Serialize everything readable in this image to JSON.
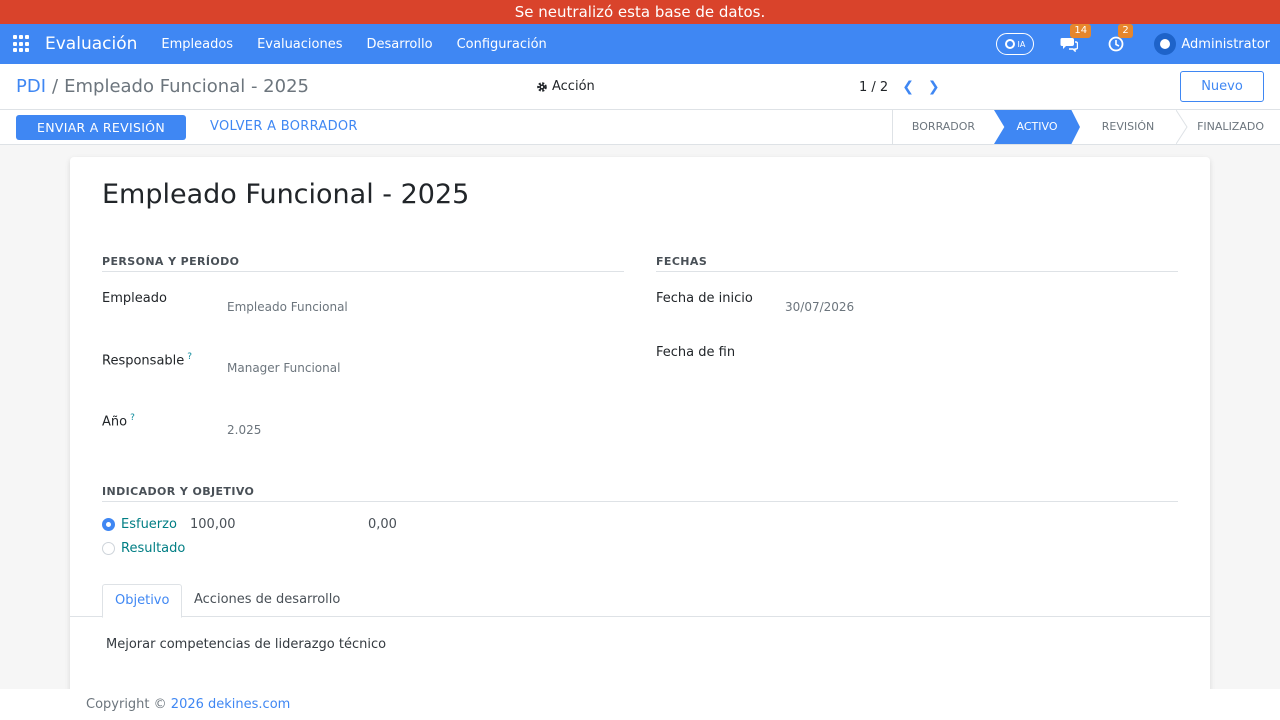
{
  "banner": {
    "text": "Se neutralizó esta base de datos."
  },
  "navbar": {
    "brand": "Evaluación",
    "menu": [
      "Empleados",
      "Evaluaciones",
      "Desarrollo",
      "Configuración"
    ],
    "ia_label": "IA",
    "messages_count": "14",
    "activities_count": "2",
    "user_name": "Administrator"
  },
  "control_panel": {
    "breadcrumb_root": "PDI",
    "breadcrumb_current": "Empleado Funcional - 2025",
    "action_label": "Acción",
    "pager": "1 / 2",
    "new_button": "Nuevo"
  },
  "statusbar": {
    "primary_button": "ENVIAR A REVISIÓN",
    "secondary_button": "VOLVER A BORRADOR",
    "stages": [
      "BORRADOR",
      "ACTIVO",
      "REVISIÓN",
      "FINALIZADO"
    ],
    "active_stage": "ACTIVO"
  },
  "form": {
    "title": "Empleado Funcional - 2025",
    "group_person": "PERSONA Y PERÍODO",
    "group_dates": "FECHAS",
    "employee_label": "Empleado",
    "employee_value": "Empleado Funcional",
    "manager_label": "Responsable",
    "manager_value": "Manager Funcional",
    "year_label": "Año",
    "year_value": "2.025",
    "start_label": "Fecha de inicio",
    "start_value": "30/07/2026",
    "end_label": "Fecha de fin",
    "end_value": "",
    "help_mark": "?",
    "group_indicator": "INDICADOR Y OBJETIVO",
    "indicator_options": [
      "Esfuerzo",
      "Resultado"
    ],
    "selected_indicator": "Esfuerzo",
    "indicator_value_1": "100,00",
    "indicator_value_2": "0,00",
    "tabs": [
      "Objetivo",
      "Acciones de desarrollo"
    ],
    "active_tab": "Objetivo",
    "objective_text": "Mejorar competencias de liderazgo técnico"
  },
  "footer": {
    "copyright_prefix": "Copyright ©",
    "copyright_link": "2026 dekines.com"
  },
  "colors": {
    "banner": "#d9432b",
    "navbar": "#3f87f3",
    "primary": "#3f87f3",
    "badge": "#e7862c"
  }
}
